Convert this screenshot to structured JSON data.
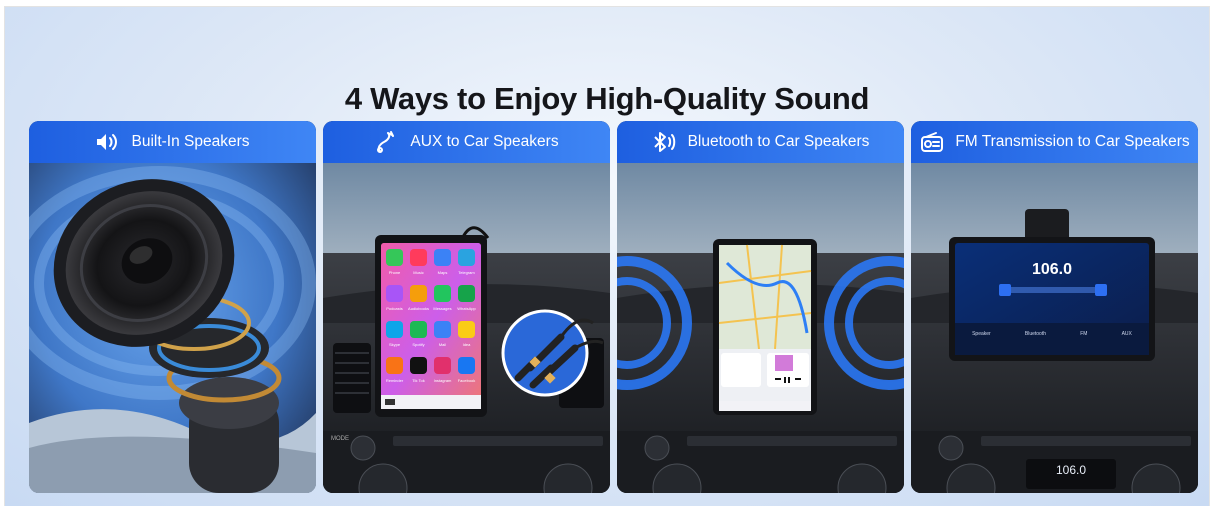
{
  "headline": "4 Ways to Enjoy High-Quality Sound",
  "cards": [
    {
      "label": "Built-In Speakers",
      "icon": "speaker-icon"
    },
    {
      "label": "AUX to Car Speakers",
      "icon": "aux-cable-icon"
    },
    {
      "label": "Bluetooth to Car Speakers",
      "icon": "bluetooth-icon"
    },
    {
      "label": "FM Transmission to Car Speakers",
      "icon": "radio-icon"
    }
  ],
  "aux_apps": [
    "Phone",
    "Music",
    "Maps",
    "Telegram",
    "Podcasts",
    "Audiobooks",
    "Messages",
    "WhatsApp",
    "Skype",
    "Spotify",
    "Mail",
    "Idea",
    "Reminder",
    "Tik Tok",
    "Instagram",
    "Facebook"
  ],
  "fm": {
    "frequency": "106.0",
    "dash_frequency": "106.0",
    "modes": [
      "Speaker",
      "Bluetooth",
      "FM",
      "AUX"
    ]
  },
  "colors": {
    "accent_start": "#1e5fe0",
    "accent_end": "#3f86f5",
    "headline": "#15161a"
  }
}
